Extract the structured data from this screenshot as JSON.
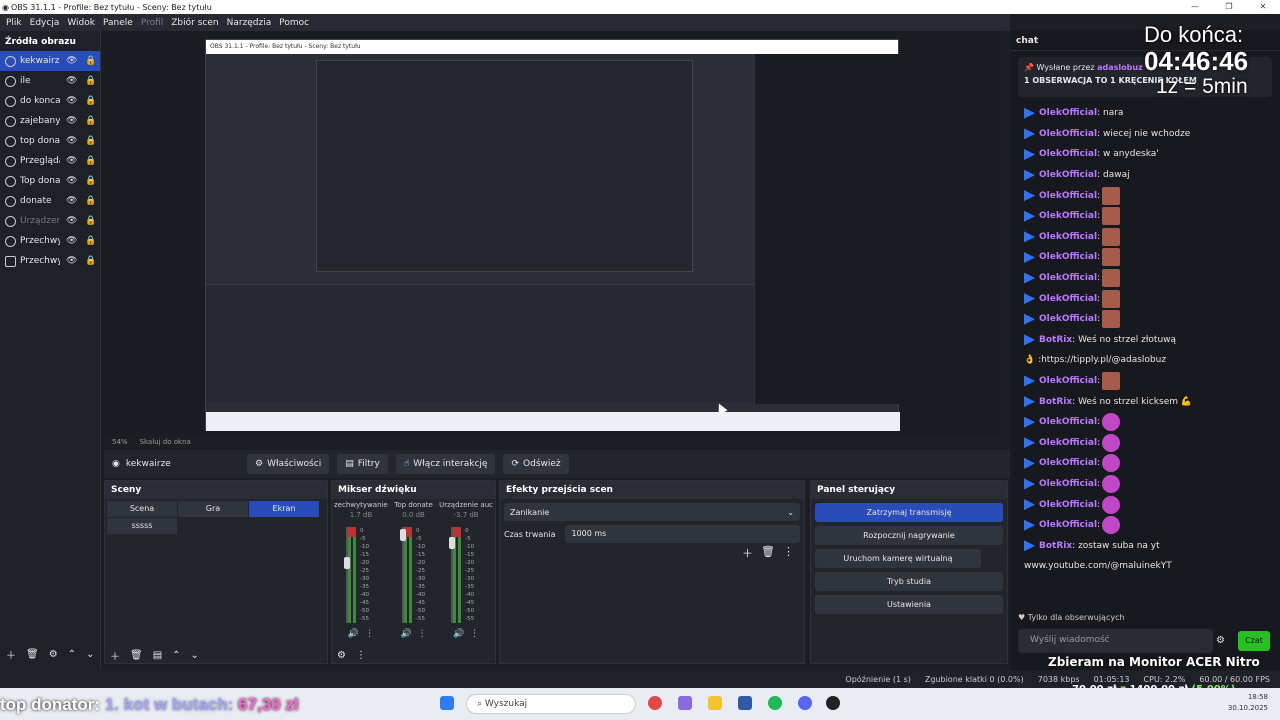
{
  "window": {
    "title": "OBS 31.1.1 - Profile: Bez tytułu - Sceny: Bez tytułu"
  },
  "menu": [
    "Plik",
    "Edycja",
    "Widok",
    "Panele",
    "Profil",
    "Zbiór scen",
    "Narzędzia",
    "Pomoc"
  ],
  "sources": {
    "title": "Źródła obrazu",
    "items": [
      "kekwairze",
      "ile",
      "do konca",
      "zajebany c",
      "top donato",
      "Przeglądar",
      "Top donati",
      "donate",
      "Urządzeni",
      "Przechwyc",
      "Przechwyc"
    ]
  },
  "preview": {
    "zoom": "54%",
    "scale_label": "Skaluj do okna",
    "inner_title": "OBS 31.1.1 - Profile: Bez tytułu - Sceny: Bez tytułu"
  },
  "controls": {
    "source_name": "kekwairze",
    "properties": "Właściwości",
    "filters": "Filtry",
    "interact": "Włącz interakcję",
    "refresh": "Odśwież"
  },
  "scenes": {
    "title": "Sceny",
    "items": [
      "Scena",
      "Gra",
      "Ekran",
      "sssss"
    ]
  },
  "mixer": {
    "title": "Mikser dźwięku",
    "channels": [
      {
        "name": "zechwytywanie we",
        "db": "1.7 dB"
      },
      {
        "name": "Top donate",
        "db": "0.0 dB"
      },
      {
        "name": "Urządzenie auc",
        "db": "-3.7 dB"
      }
    ],
    "ticks": [
      "0",
      "-5",
      "-10",
      "-15",
      "-20",
      "-25",
      "-30",
      "-35",
      "-40",
      "-45",
      "-50",
      "-55",
      "-60"
    ]
  },
  "transitions": {
    "title": "Efekty przejścia scen",
    "selected": "Zanikanie",
    "duration_label": "Czas trwania",
    "duration": "1000 ms"
  },
  "panel": {
    "title": "Panel sterujący",
    "buttons": [
      "Zatrzymaj transmisję",
      "Rozpocznij nagrywanie",
      "Uruchom kamerę wirtualną",
      "Tryb studia",
      "Ustawienia"
    ]
  },
  "status": {
    "delay": "Opóźnienie (1 s)",
    "dropped": "Zgubione klatki 0 (0.0%)",
    "kbps": "7038 kbps",
    "time": "01:05:13",
    "cpu": "CPU: 2.2%",
    "fps": "60.00 / 60.00 FPS"
  },
  "chat": {
    "title": "chat",
    "pinned_by": "Wysłane przez",
    "pinned_user": "adaslobuz",
    "pinned_text": "1 OBSERWACJA TO 1 KRĘCENIE KOŁEM",
    "messages": [
      {
        "user": "OlekOfficial",
        "text": ": nara"
      },
      {
        "user": "OlekOfficial",
        "text": ": wiecej nie wchodze"
      },
      {
        "user": "OlekOfficial",
        "text": ": w anydeska'"
      },
      {
        "user": "OlekOfficial",
        "text": ": dawaj"
      },
      {
        "user": "OlekOfficial",
        "text": ":",
        "emote": "b"
      },
      {
        "user": "OlekOfficial",
        "text": ":",
        "emote": "b"
      },
      {
        "user": "OlekOfficial",
        "text": ":",
        "emote": "b"
      },
      {
        "user": "OlekOfficial",
        "text": ":",
        "emote": "b"
      },
      {
        "user": "OlekOfficial",
        "text": ":",
        "emote": "b"
      },
      {
        "user": "OlekOfficial",
        "text": ":",
        "emote": "b"
      },
      {
        "user": "OlekOfficial",
        "text": ":",
        "emote": "b"
      },
      {
        "user": "BotRix",
        "text": ": Weś no strzel złotuwą"
      },
      {
        "user": "",
        "text": "👌 :https://tipply.pl/@adaslobuz"
      },
      {
        "user": "OlekOfficial",
        "text": ":",
        "emote": "b"
      },
      {
        "user": "BotRix",
        "text": ": Weś no strzel kicksem 💪"
      },
      {
        "user": "OlekOfficial",
        "text": ":",
        "emote": "p"
      },
      {
        "user": "OlekOfficial",
        "text": ":",
        "emote": "p"
      },
      {
        "user": "OlekOfficial",
        "text": ":",
        "emote": "p"
      },
      {
        "user": "OlekOfficial",
        "text": ":",
        "emote": "p"
      },
      {
        "user": "OlekOfficial",
        "text": ":",
        "emote": "p"
      },
      {
        "user": "OlekOfficial",
        "text": ":",
        "emote": "p"
      },
      {
        "user": "BotRix",
        "text": ": zostaw suba na yt"
      },
      {
        "user": "",
        "text": "www.youtube.com/@maluinekYT"
      }
    ],
    "followers_only": "Tylko dla obserwujących",
    "placeholder": "Wyślij wiadomość",
    "send": "Czat"
  },
  "overlay": {
    "timer_label": "Do końca:",
    "timer": "04:46:46",
    "rate": "1z = 5min",
    "goal_title": "Zbieram na Monitor ACER Nitro",
    "goal_current": "70,00 zł",
    "goal_sep": "z",
    "goal_total": "1400,00 zł",
    "goal_pct": "(5.00%)",
    "donor_label": "top donator:",
    "donor_name": "1. kot w butach:",
    "donor_amount": "67,30 zł"
  },
  "taskbar": {
    "search": "Wyszukaj",
    "time": "18:58",
    "date": "30.10.2025"
  }
}
